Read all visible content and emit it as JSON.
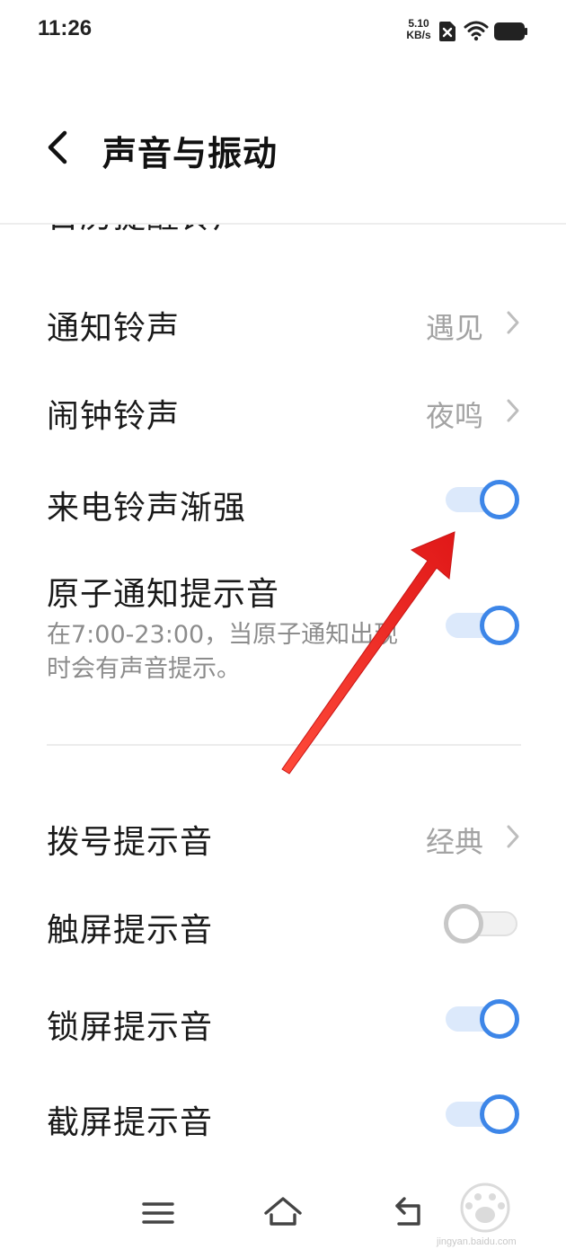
{
  "status_bar": {
    "time": "11:26",
    "net_speed_value": "5.10",
    "net_speed_unit": "KB/s",
    "icons": [
      "sim-off-icon",
      "wifi-icon",
      "battery-icon"
    ]
  },
  "header": {
    "title": "声音与振动",
    "back_icon": "chevron-left-icon"
  },
  "settings": {
    "calendar_ringtone": {
      "label": "日历提醒铃声"
    },
    "notification_ringtone": {
      "label": "通知铃声",
      "value": "遇见"
    },
    "alarm_ringtone": {
      "label": "闹钟铃声",
      "value": "夜鸣"
    },
    "ringtone_fade_in": {
      "label": "来电铃声渐强",
      "enabled": true
    },
    "atomic_notification_sound": {
      "label": "原子通知提示音",
      "description": "在7:00-23:00，当原子通知出现时会有声音提示。",
      "enabled": true
    },
    "dial_tone": {
      "label": "拨号提示音",
      "value": "经典"
    },
    "touch_sound": {
      "label": "触屏提示音",
      "enabled": false
    },
    "lock_sound": {
      "label": "锁屏提示音",
      "enabled": true
    },
    "screenshot_sound": {
      "label": "截屏提示音",
      "enabled": true
    }
  },
  "colors": {
    "accent": "#3d86e8",
    "toggle_track_on": "#dce9fb",
    "annotation_arrow": "#e8201e",
    "secondary_text": "#a3a3a3"
  },
  "nav_bar": {
    "icons": [
      "menu-icon",
      "home-icon",
      "back-icon"
    ]
  },
  "watermark": {
    "text": "jingyan.baidu.com"
  }
}
